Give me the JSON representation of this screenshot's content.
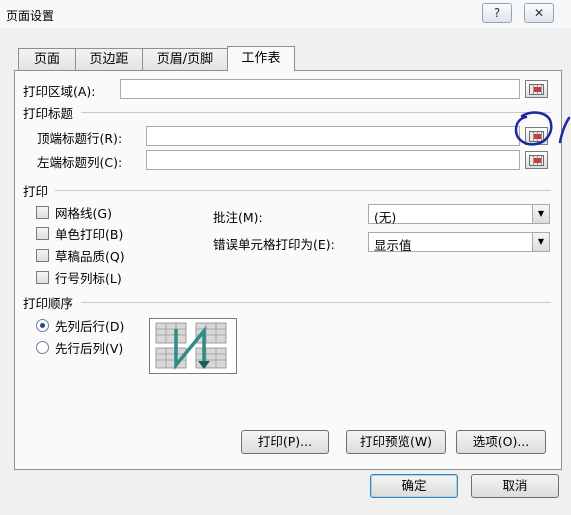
{
  "window": {
    "title": "页面设置",
    "help": "?",
    "close": "✕"
  },
  "tabs": [
    {
      "label": "页面"
    },
    {
      "label": "页边距"
    },
    {
      "label": "页眉/页脚"
    },
    {
      "label": "工作表"
    }
  ],
  "print_area": {
    "label": "打印区域(A):",
    "value": ""
  },
  "print_titles": {
    "heading": "打印标题",
    "top_rows": {
      "label": "顶端标题行(R):",
      "value": ""
    },
    "left_cols": {
      "label": "左端标题列(C):",
      "value": ""
    }
  },
  "print": {
    "heading": "打印",
    "checkboxes": [
      {
        "label": "网格线(G)"
      },
      {
        "label": "单色打印(B)"
      },
      {
        "label": "草稿品质(Q)"
      },
      {
        "label": "行号列标(L)"
      }
    ],
    "comments": {
      "label": "批注(M):",
      "value": "(无)"
    },
    "errors": {
      "label": "错误单元格打印为(E):",
      "value": "显示值"
    }
  },
  "page_order": {
    "heading": "打印顺序",
    "options": [
      {
        "label": "先列后行(D)",
        "selected": true
      },
      {
        "label": "先行后列(V)",
        "selected": false
      }
    ]
  },
  "buttons": {
    "print": "打印(P)...",
    "preview": "打印预览(W)",
    "options": "选项(O)...",
    "ok": "确定",
    "cancel": "取消"
  },
  "colors": {
    "annotation": "#1e2a9c",
    "order_arrow": "#2e8c84",
    "picker_mark": "#c83b3b"
  },
  "icons": {
    "cell_picker": "range-select-icon",
    "page_order_preview": "page-order-diagram-icon"
  }
}
